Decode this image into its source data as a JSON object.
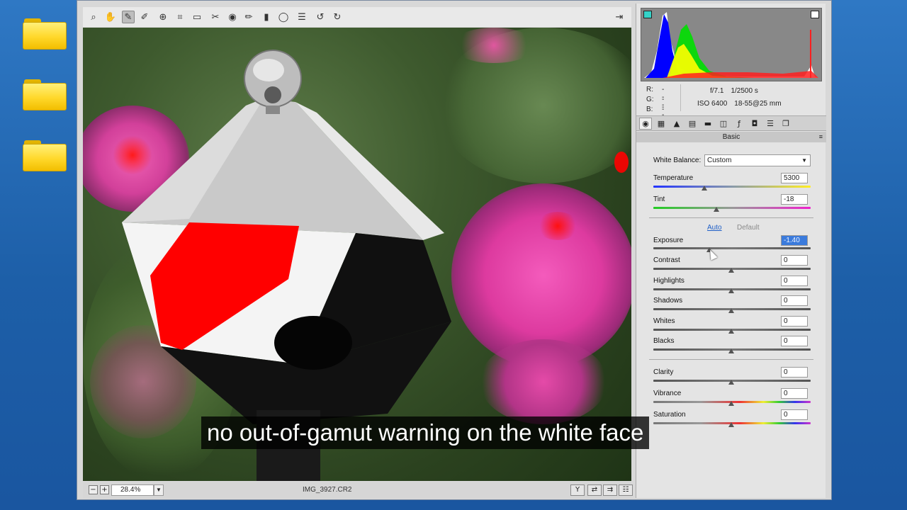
{
  "desktop": {
    "icons": [
      "folder-icon",
      "folder-icon",
      "folder-icon"
    ]
  },
  "toolbar": {
    "tools": [
      "zoom-icon",
      "hand-icon",
      "white-balance-icon",
      "color-sampler-icon",
      "target-adjustment-icon",
      "crop-icon",
      "straighten-icon",
      "spot-removal-icon",
      "red-eye-icon",
      "adjustment-brush-icon",
      "graduated-filter-icon",
      "radial-filter-icon",
      "preferences-icon",
      "rotate-left-icon",
      "rotate-right-icon"
    ],
    "fullscreen_icon": "fullscreen-icon"
  },
  "statusbar": {
    "zoom_out": "−",
    "zoom_in": "+",
    "zoom": "28.4%",
    "filename": "IMG_3927.CR2"
  },
  "readout": {
    "r_label": "R:",
    "r_value": "---",
    "g_label": "G:",
    "g_value": "---",
    "b_label": "B:",
    "b_value": "---",
    "aperture": "f/7.1",
    "shutter": "1/2500 s",
    "iso": "ISO 6400",
    "lens": "18-55@25 mm"
  },
  "panel": {
    "section_title": "Basic",
    "white_balance": {
      "label": "White Balance:",
      "value": "Custom"
    },
    "auto_label": "Auto",
    "default_label": "Default",
    "sliders": [
      {
        "key": "temperature",
        "label": "Temperature",
        "value": "5300"
      },
      {
        "key": "tint",
        "label": "Tint",
        "value": "-18"
      },
      {
        "key": "exposure",
        "label": "Exposure",
        "value": "-1.40"
      },
      {
        "key": "contrast",
        "label": "Contrast",
        "value": "0"
      },
      {
        "key": "highlights",
        "label": "Highlights",
        "value": "0"
      },
      {
        "key": "shadows",
        "label": "Shadows",
        "value": "0"
      },
      {
        "key": "whites",
        "label": "Whites",
        "value": "0"
      },
      {
        "key": "blacks",
        "label": "Blacks",
        "value": "0"
      },
      {
        "key": "clarity",
        "label": "Clarity",
        "value": "0"
      },
      {
        "key": "vibrance",
        "label": "Vibrance",
        "value": "0"
      },
      {
        "key": "saturation",
        "label": "Saturation",
        "value": "0"
      }
    ]
  },
  "subtitle": "no out-of-gamut warning on the white face"
}
